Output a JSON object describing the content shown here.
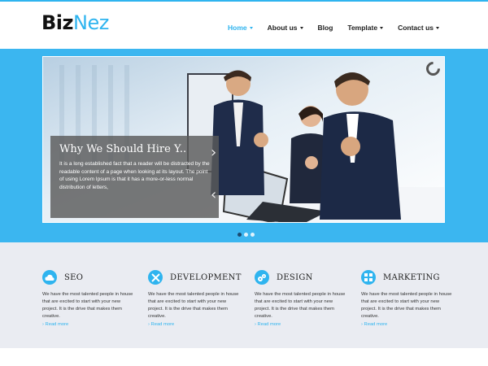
{
  "brand": {
    "part1": "Biz",
    "part2": "Nez"
  },
  "nav": {
    "items": [
      {
        "label": "Home",
        "active": true,
        "dropdown": true
      },
      {
        "label": "About us",
        "active": false,
        "dropdown": true
      },
      {
        "label": "Blog",
        "active": false,
        "dropdown": false
      },
      {
        "label": "Template",
        "active": false,
        "dropdown": true
      },
      {
        "label": "Contact us",
        "active": false,
        "dropdown": true
      }
    ]
  },
  "slider": {
    "title": "Why We Should Hire Y..",
    "text": "It is a long established fact that a reader will be distracted by the readable content of a page when looking at its layout. The point of using Lorem Ipsum is that it has a more-or-less normal distribution of letters,",
    "prev_icon": "chevron-right-icon",
    "next_icon": "chevron-left-icon",
    "dots": 3,
    "active_dot": 0
  },
  "features": [
    {
      "title": "SEO",
      "icon": "cloud-icon",
      "desc": "We have the most talented people in house that are excited to start with your new project. It is the drive that makes them creative.",
      "more": "Read more"
    },
    {
      "title": "DEVELOPMENT",
      "icon": "tools-icon",
      "desc": "We have the most talented people in house that are excited to start with your new project. It is the drive that makes them creative.",
      "more": "Read more"
    },
    {
      "title": "DESIGN",
      "icon": "gears-icon",
      "desc": "We have the most talented people in house that are excited to start with your new project. It is the drive that makes them creative.",
      "more": "Read more"
    },
    {
      "title": "MARKETING",
      "icon": "grid-icon",
      "desc": "We have the most talented people in house that are excited to start with your new project. It is the drive that makes them creative.",
      "more": "Read more"
    }
  ],
  "colors": {
    "accent": "#2fb4ef",
    "hero_bg": "#3bb6f0",
    "features_bg": "#eaecf2"
  },
  "corner_button": "+"
}
